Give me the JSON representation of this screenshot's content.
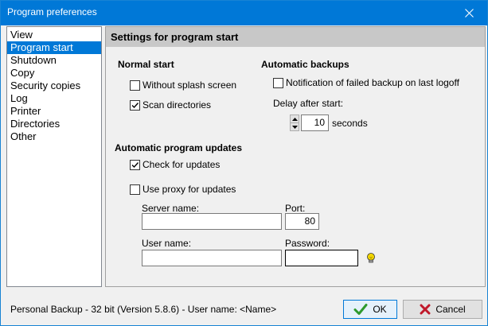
{
  "window": {
    "title": "Program preferences",
    "close_label": "Close"
  },
  "nav": {
    "items": [
      "View",
      "Program start",
      "Shutdown",
      "Copy",
      "Security copies",
      "Log",
      "Printer",
      "Directories",
      "Other"
    ],
    "selected": "Program start"
  },
  "panel": {
    "title": "Settings for program start",
    "normal_start": {
      "heading": "Normal start",
      "without_splash": {
        "label": "Without splash screen",
        "checked": false
      },
      "scan_dirs": {
        "label": "Scan directories",
        "checked": true
      }
    },
    "auto_backups": {
      "heading": "Automatic backups",
      "notify_failed": {
        "label": "Notification of failed backup on last logoff",
        "checked": false
      },
      "delay_label": "Delay after start:",
      "delay_value": "10",
      "delay_unit": "seconds"
    },
    "updates": {
      "heading": "Automatic program updates",
      "check": {
        "label": "Check for updates",
        "checked": true
      },
      "proxy": {
        "label": "Use proxy for updates",
        "checked": false
      },
      "server_label": "Server name:",
      "server_value": "",
      "port_label": "Port:",
      "port_value": "80",
      "user_label": "User name:",
      "user_value": "",
      "password_label": "Password:",
      "password_value": ""
    }
  },
  "footer": {
    "status": "Personal Backup - 32 bit (Version 5.8.6) - User name: <Name>",
    "ok_label": "OK",
    "cancel_label": "Cancel"
  },
  "icons": {
    "ok": "checkmark-icon",
    "cancel": "red-x-icon",
    "hint": "lightbulb-icon",
    "close": "close-icon"
  },
  "colors": {
    "titlebar": "#0078d7",
    "selection": "#0078d7",
    "panel_header": "#c8c8c8",
    "ok_check": "#2e9a2e",
    "cancel_x": "#c0182a",
    "bulb": "#f2d600"
  }
}
